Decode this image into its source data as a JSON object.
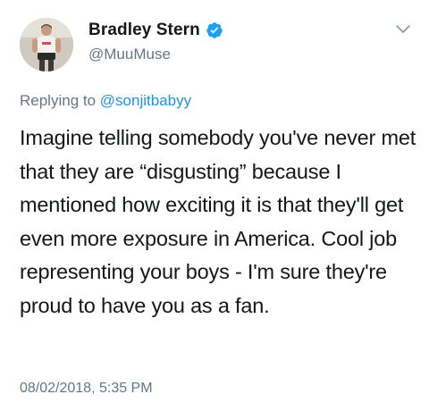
{
  "author": {
    "display_name": "Bradley Stern",
    "handle": "@MuuMuse",
    "verified": true,
    "avatar_icon": "profile-photo",
    "verified_color": "#1da1f2"
  },
  "reply": {
    "prefix": "Replying to ",
    "mention": "@sonjitbabyy"
  },
  "tweet": {
    "text": "Imagine telling somebody you've never met that they are “disgusting” because I mentioned how exciting it is that they'll get even more exposure in America. Cool job representing your boys - I'm sure they're proud to have you as a fan.",
    "timestamp": "08/02/2018, 5:35 PM"
  },
  "controls": {
    "menu_icon": "chevron-down-icon"
  },
  "colors": {
    "text": "#14171a",
    "secondary": "#657786",
    "link": "#1b95e0"
  }
}
